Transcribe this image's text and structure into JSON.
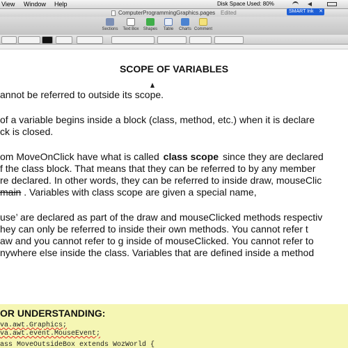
{
  "menubar": {
    "items": [
      "View",
      "Window",
      "Help"
    ],
    "disk_space": "Disk Space Used: 80%",
    "status_icons": [
      "network-icon",
      "volume-icon",
      "battery-icon"
    ]
  },
  "titlebar": {
    "filename": "ComputerProgrammingGraphics.pages",
    "state": "Edited"
  },
  "smart_ink": {
    "label": "SMART Ink"
  },
  "toolbar": {
    "buttons": [
      "Sections",
      "Text Box",
      "Shapes",
      "Table",
      "Charts",
      "Comment"
    ]
  },
  "doc": {
    "title": "SCOPE OF VARIABLES",
    "lines": [
      "annot be referred to outside its scope.",
      "of a variable begins inside a block (class, method, etc.) when it is declare",
      "ck is closed.",
      "om MoveOnClick have what is called",
      "class scope",
      "since they are declared",
      "f the class block.  That means that they can be referred to by any member",
      "re declared.  In other words, they can be referred to inside draw, mouseClic",
      "main",
      ".  Variables with class scope are given a special name,",
      "use’ are declared as part of the draw and mouseClicked methods respectiv",
      "hey can only be referred to inside their own methods.  You cannot refer t",
      "aw and you cannot refer to g inside of mouseClicked.  You cannot refer to",
      "nywhere else inside the class.  Variables that are defined inside a method"
    ],
    "understanding_heading": "OR UNDERSTANDING:",
    "code_lines": [
      "va.awt.Graphics;",
      "va.awt.event.MouseEvent;",
      "ass MoveOutsideBox extends WozWorld {"
    ]
  },
  "colors": {
    "code_highlight": "#f5f6b4",
    "smart_ink_blue": "#1e5fd6",
    "squiggle_red": "#d22222"
  }
}
